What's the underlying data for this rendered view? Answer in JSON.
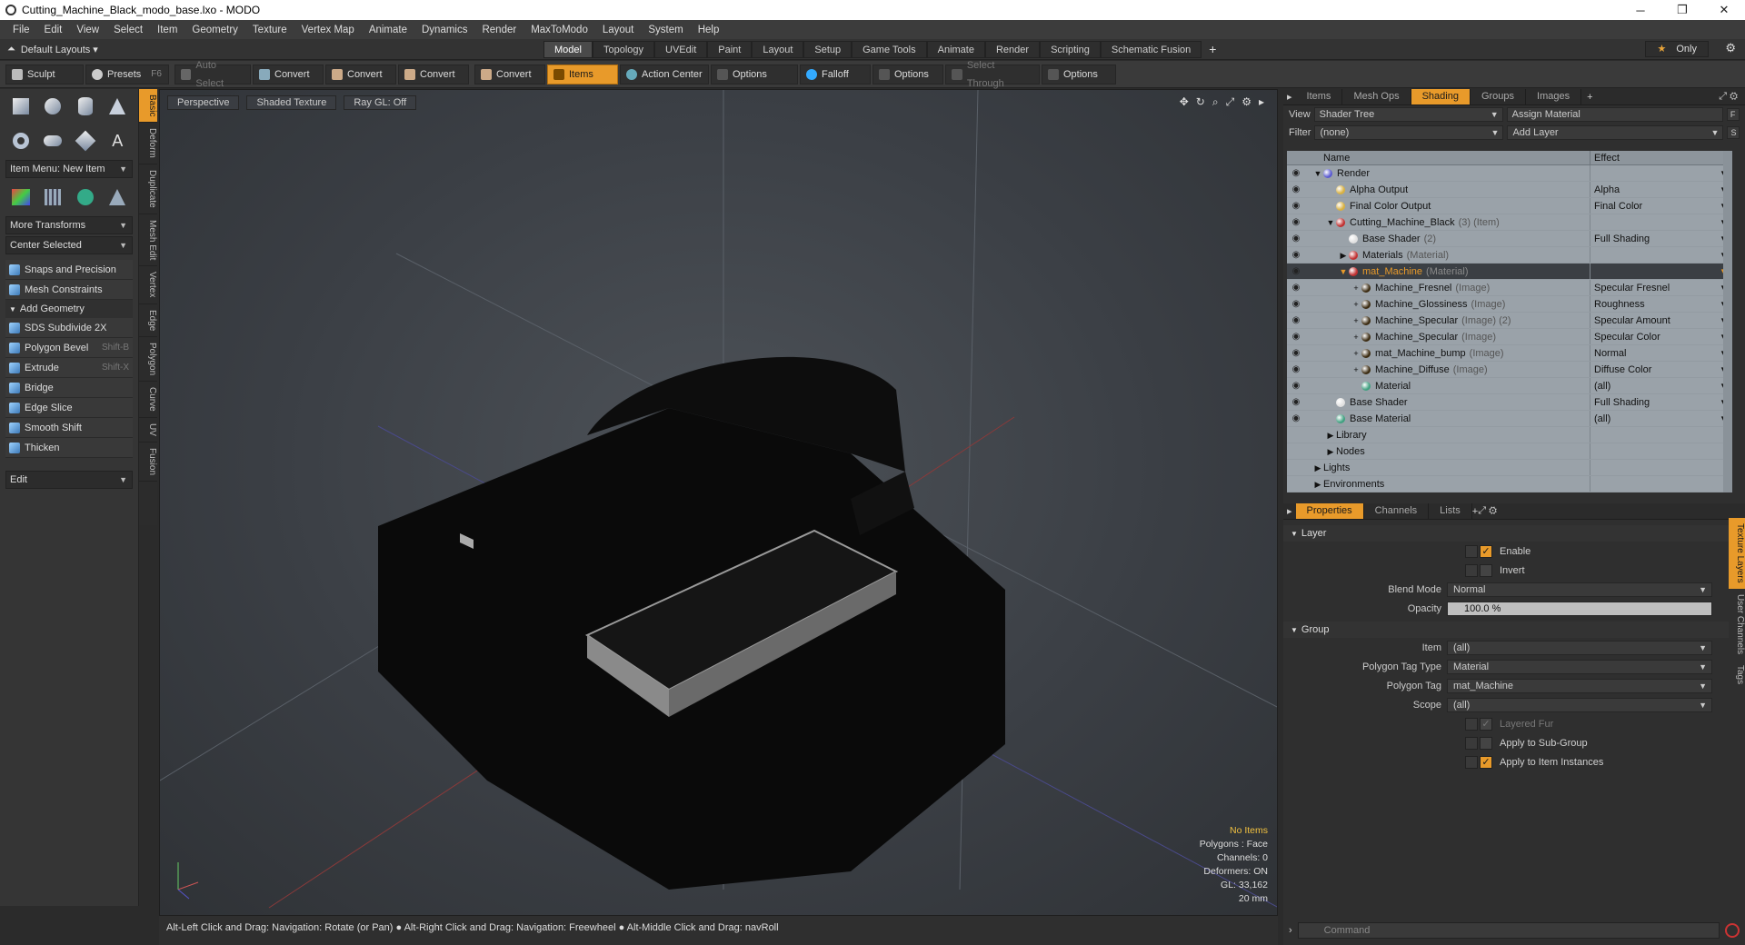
{
  "window": {
    "title": "Cutting_Machine_Black_modo_base.lxo - MODO",
    "min": "─",
    "max": "❐",
    "close": "✕"
  },
  "menu": [
    "File",
    "Edit",
    "View",
    "Select",
    "Item",
    "Geometry",
    "Texture",
    "Vertex Map",
    "Animate",
    "Dynamics",
    "Render",
    "MaxToModo",
    "Layout",
    "System",
    "Help"
  ],
  "layouts": {
    "default_label": "Default Layouts ▾",
    "tabs": [
      "Model",
      "Topology",
      "UVEdit",
      "Paint",
      "Layout",
      "Setup",
      "Game Tools",
      "Animate",
      "Render",
      "Scripting",
      "Schematic Fusion"
    ],
    "active_tab": "Model",
    "add": "+",
    "only_label": "Only",
    "star": "★",
    "gear": "⚙"
  },
  "toolbar": {
    "sculpt": "Sculpt",
    "presets": "Presets",
    "presets_hotkey": "F6",
    "auto_select": "Auto Select",
    "convert1": "Convert",
    "convert2": "Convert",
    "convert3": "Convert",
    "convert4": "Convert",
    "items": "Items",
    "action_center": "Action Center",
    "options1": "Options",
    "falloff": "Falloff",
    "options2": "Options",
    "select_through": "Select Through",
    "options3": "Options"
  },
  "left": {
    "item_menu": "Item Menu: New Item",
    "more_transforms": "More Transforms",
    "center_selected": "Center Selected",
    "snaps": "Snaps and Precision",
    "mesh_constraints": "Mesh Constraints",
    "add_geometry": "Add Geometry",
    "tools": [
      {
        "label": "SDS Subdivide 2X",
        "hotkey": ""
      },
      {
        "label": "Polygon Bevel",
        "hotkey": "Shift-B"
      },
      {
        "label": "Extrude",
        "hotkey": "Shift-X"
      },
      {
        "label": "Bridge",
        "hotkey": ""
      },
      {
        "label": "Edge Slice",
        "hotkey": ""
      },
      {
        "label": "Smooth Shift",
        "hotkey": ""
      },
      {
        "label": "Thicken",
        "hotkey": ""
      }
    ],
    "edit": "Edit",
    "vtabs": [
      "Basic",
      "Deform",
      "Duplicate",
      "Mesh Edit",
      "Vertex",
      "Edge",
      "Polygon",
      "Curve",
      "UV",
      "Fusion"
    ]
  },
  "viewport": {
    "perspective": "Perspective",
    "shading": "Shaded Texture",
    "raygl": "Ray GL: Off",
    "stats": {
      "no_items": "No Items",
      "polygons": "Polygons : Face",
      "channels": "Channels: 0",
      "deformers": "Deformers: ON",
      "gl": "GL: 33,162",
      "scale": "20 mm"
    }
  },
  "status": "Alt-Left Click and Drag: Navigation: Rotate (or Pan) ● Alt-Right Click and Drag: Navigation: Freewheel ● Alt-Middle Click and Drag: navRoll",
  "right": {
    "tabs": [
      "Items",
      "Mesh Ops",
      "Shading",
      "Groups",
      "Images"
    ],
    "active_tab": "Shading",
    "view_label": "View",
    "view_value": "Shader Tree",
    "assign_material": "Assign Material",
    "filter_label": "Filter",
    "filter_value": "(none)",
    "add_layer": "Add Layer",
    "col_name": "Name",
    "col_effect": "Effect",
    "tree": [
      {
        "name": "Render",
        "type": "",
        "effect": "",
        "indent": 0,
        "exp": "▼",
        "color": "#5a5ad0"
      },
      {
        "name": "Alpha Output",
        "type": "",
        "effect": "Alpha",
        "indent": 1,
        "exp": "",
        "color": "#d8b040"
      },
      {
        "name": "Final Color Output",
        "type": "",
        "effect": "Final Color",
        "indent": 1,
        "exp": "",
        "color": "#d8b040"
      },
      {
        "name": "Cutting_Machine_Black",
        "type": "(3) (Item)",
        "effect": "",
        "indent": 1,
        "exp": "▼",
        "color": "#c03030"
      },
      {
        "name": "Base Shader",
        "type": "(2)",
        "effect": "Full Shading",
        "indent": 2,
        "exp": "",
        "color": "#e0e0e0"
      },
      {
        "name": "Materials",
        "type": "(Material)",
        "effect": "",
        "indent": 2,
        "exp": "▶",
        "color": "#c03030"
      },
      {
        "name": "mat_Machine",
        "type": "(Material)",
        "effect": "",
        "indent": 2,
        "exp": "▼",
        "color": "#c03030",
        "selected": true
      },
      {
        "name": "Machine_Fresnel",
        "type": "(Image)",
        "effect": "Specular Fresnel",
        "indent": 3,
        "exp": "+",
        "color": "#3a2a10"
      },
      {
        "name": "Machine_Glossiness",
        "type": "(Image)",
        "effect": "Roughness",
        "indent": 3,
        "exp": "+",
        "color": "#3a2a10"
      },
      {
        "name": "Machine_Specular",
        "type": "(Image) (2)",
        "effect": "Specular Amount",
        "indent": 3,
        "exp": "+",
        "color": "#3a2a10"
      },
      {
        "name": "Machine_Specular",
        "type": "(Image)",
        "effect": "Specular Color",
        "indent": 3,
        "exp": "+",
        "color": "#3a2a10"
      },
      {
        "name": "mat_Machine_bump",
        "type": "(Image)",
        "effect": "Normal",
        "indent": 3,
        "exp": "+",
        "color": "#3a2a10"
      },
      {
        "name": "Machine_Diffuse",
        "type": "(Image)",
        "effect": "Diffuse Color",
        "indent": 3,
        "exp": "+",
        "color": "#3a2a10"
      },
      {
        "name": "Material",
        "type": "",
        "effect": "(all)",
        "indent": 3,
        "exp": "",
        "color": "#40a080"
      },
      {
        "name": "Base Shader",
        "type": "",
        "effect": "Full Shading",
        "indent": 1,
        "exp": "",
        "color": "#e0e0e0"
      },
      {
        "name": "Base Material",
        "type": "",
        "effect": "(all)",
        "indent": 1,
        "exp": "",
        "color": "#40a080"
      },
      {
        "name": "Library",
        "type": "",
        "effect": "",
        "indent": 1,
        "exp": "▶",
        "color": ""
      },
      {
        "name": "Nodes",
        "type": "",
        "effect": "",
        "indent": 1,
        "exp": "▶",
        "color": ""
      },
      {
        "name": "Lights",
        "type": "",
        "effect": "",
        "indent": 0,
        "exp": "▶",
        "color": ""
      },
      {
        "name": "Environments",
        "type": "",
        "effect": "",
        "indent": 0,
        "exp": "▶",
        "color": ""
      }
    ],
    "ptabs": [
      "Properties",
      "Channels",
      "Lists"
    ],
    "props": {
      "layer": "Layer",
      "enable": "Enable",
      "invert": "Invert",
      "blend_mode_label": "Blend Mode",
      "blend_mode": "Normal",
      "opacity_label": "Opacity",
      "opacity": "100.0 %",
      "group": "Group",
      "item_label": "Item",
      "item": "(all)",
      "ptt_label": "Polygon Tag Type",
      "ptt": "Material",
      "pt_label": "Polygon Tag",
      "pt": "mat_Machine",
      "scope_label": "Scope",
      "scope": "(all)",
      "layered_fur": "Layered Fur",
      "apply_sub": "Apply to Sub-Group",
      "apply_inst": "Apply to Item Instances"
    },
    "rvtabs": [
      "Texture Layers",
      "User Channels",
      "Tags"
    ],
    "command": "Command"
  }
}
